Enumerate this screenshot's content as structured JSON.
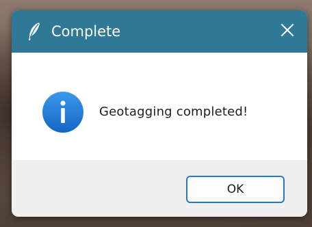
{
  "window": {
    "title": "Complete",
    "app_icon": "feather-icon",
    "close_icon": "close-icon"
  },
  "dialog": {
    "icon": "info-icon",
    "message": "Geotagging completed!"
  },
  "buttons": {
    "ok_label": "OK"
  },
  "colors": {
    "titlebar": "#2f7896",
    "info_icon": "#1a74d6",
    "ok_border": "#1f78d2",
    "footer": "#f0f0f0"
  }
}
